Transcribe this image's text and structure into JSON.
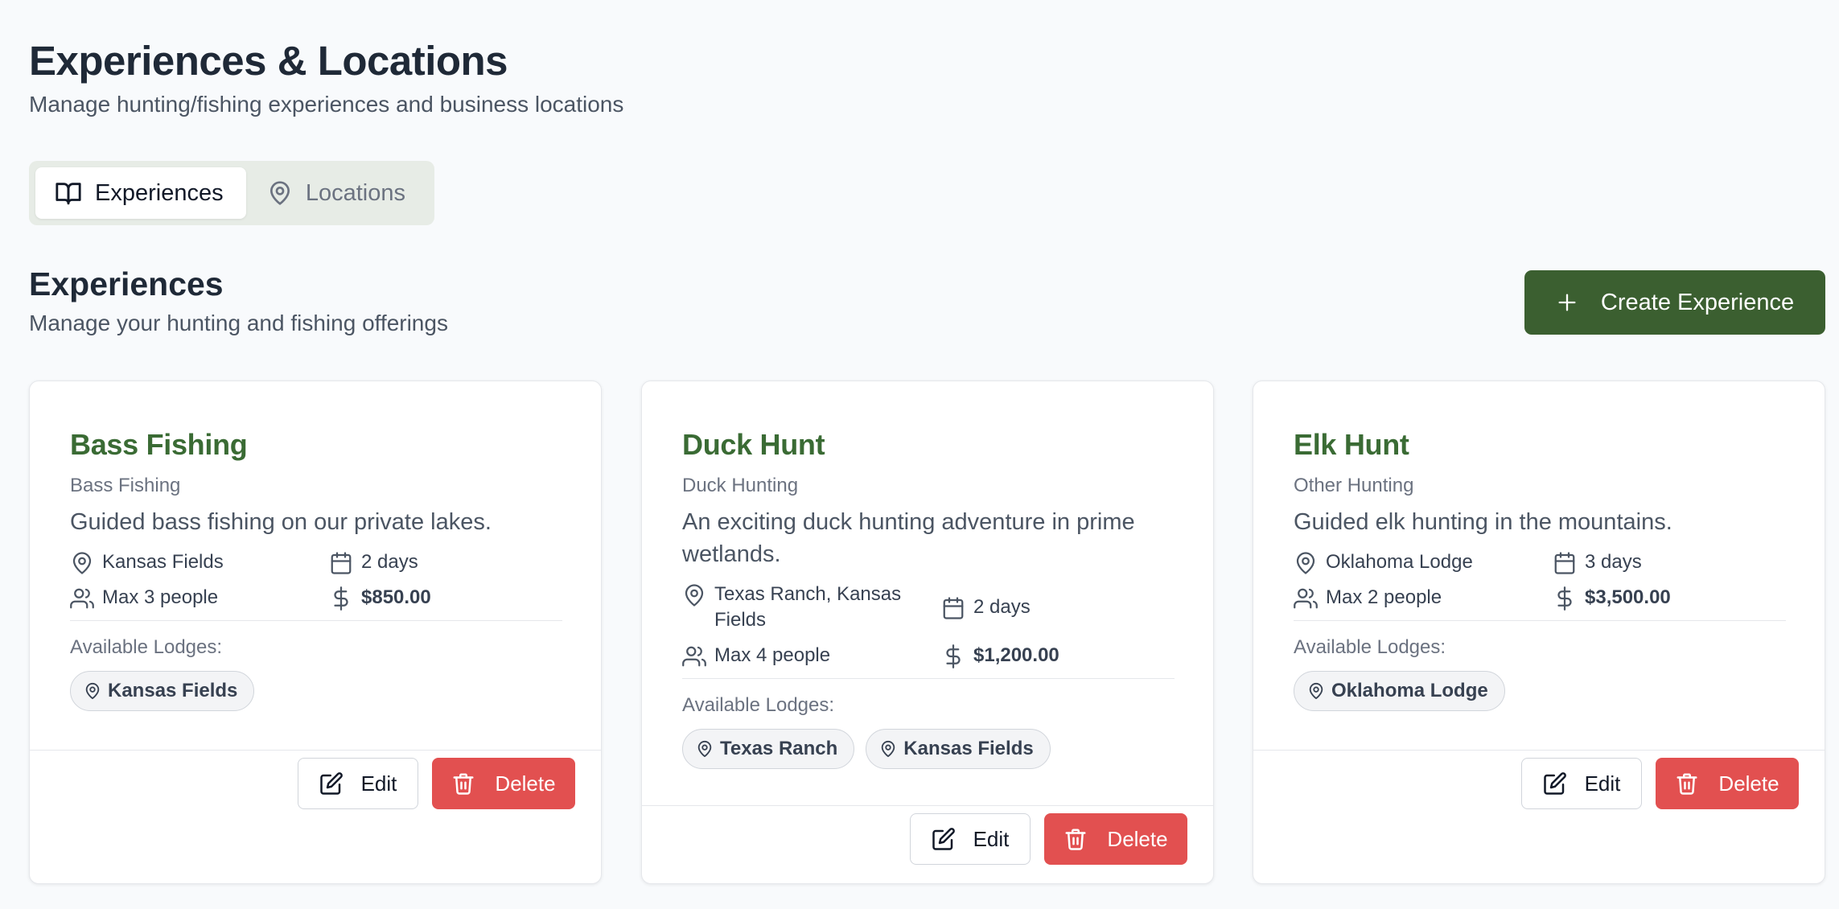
{
  "header": {
    "title": "Experiences & Locations",
    "subtitle": "Manage hunting/fishing experiences and business locations"
  },
  "tabs": [
    {
      "label": "Experiences",
      "icon": "book-open-icon",
      "active": true
    },
    {
      "label": "Locations",
      "icon": "map-pin-icon",
      "active": false
    }
  ],
  "section": {
    "title": "Experiences",
    "subtitle": "Manage your hunting and fishing offerings",
    "create_label": "Create Experience"
  },
  "colors": {
    "accent_green": "#3b5f30",
    "title_green": "#3a6b34",
    "delete_red": "#e25050"
  },
  "cards": [
    {
      "title": "Bass Fishing",
      "category": "Bass Fishing",
      "description": "Guided bass fishing on our private lakes.",
      "location": "Kansas Fields",
      "duration": "2 days",
      "capacity": "Max 3 people",
      "price": "$850.00",
      "lodges_label": "Available Lodges:",
      "lodges": [
        "Kansas Fields"
      ],
      "edit_label": "Edit",
      "delete_label": "Delete"
    },
    {
      "title": "Duck Hunt",
      "category": "Duck Hunting",
      "description": "An exciting duck hunting adventure in prime wetlands.",
      "location": "Texas Ranch, Kansas Fields",
      "duration": "2 days",
      "capacity": "Max 4 people",
      "price": "$1,200.00",
      "lodges_label": "Available Lodges:",
      "lodges": [
        "Texas Ranch",
        "Kansas Fields"
      ],
      "edit_label": "Edit",
      "delete_label": "Delete"
    },
    {
      "title": "Elk Hunt",
      "category": "Other Hunting",
      "description": "Guided elk hunting in the mountains.",
      "location": "Oklahoma Lodge",
      "duration": "3 days",
      "capacity": "Max 2 people",
      "price": "$3,500.00",
      "lodges_label": "Available Lodges:",
      "lodges": [
        "Oklahoma Lodge"
      ],
      "edit_label": "Edit",
      "delete_label": "Delete"
    }
  ]
}
